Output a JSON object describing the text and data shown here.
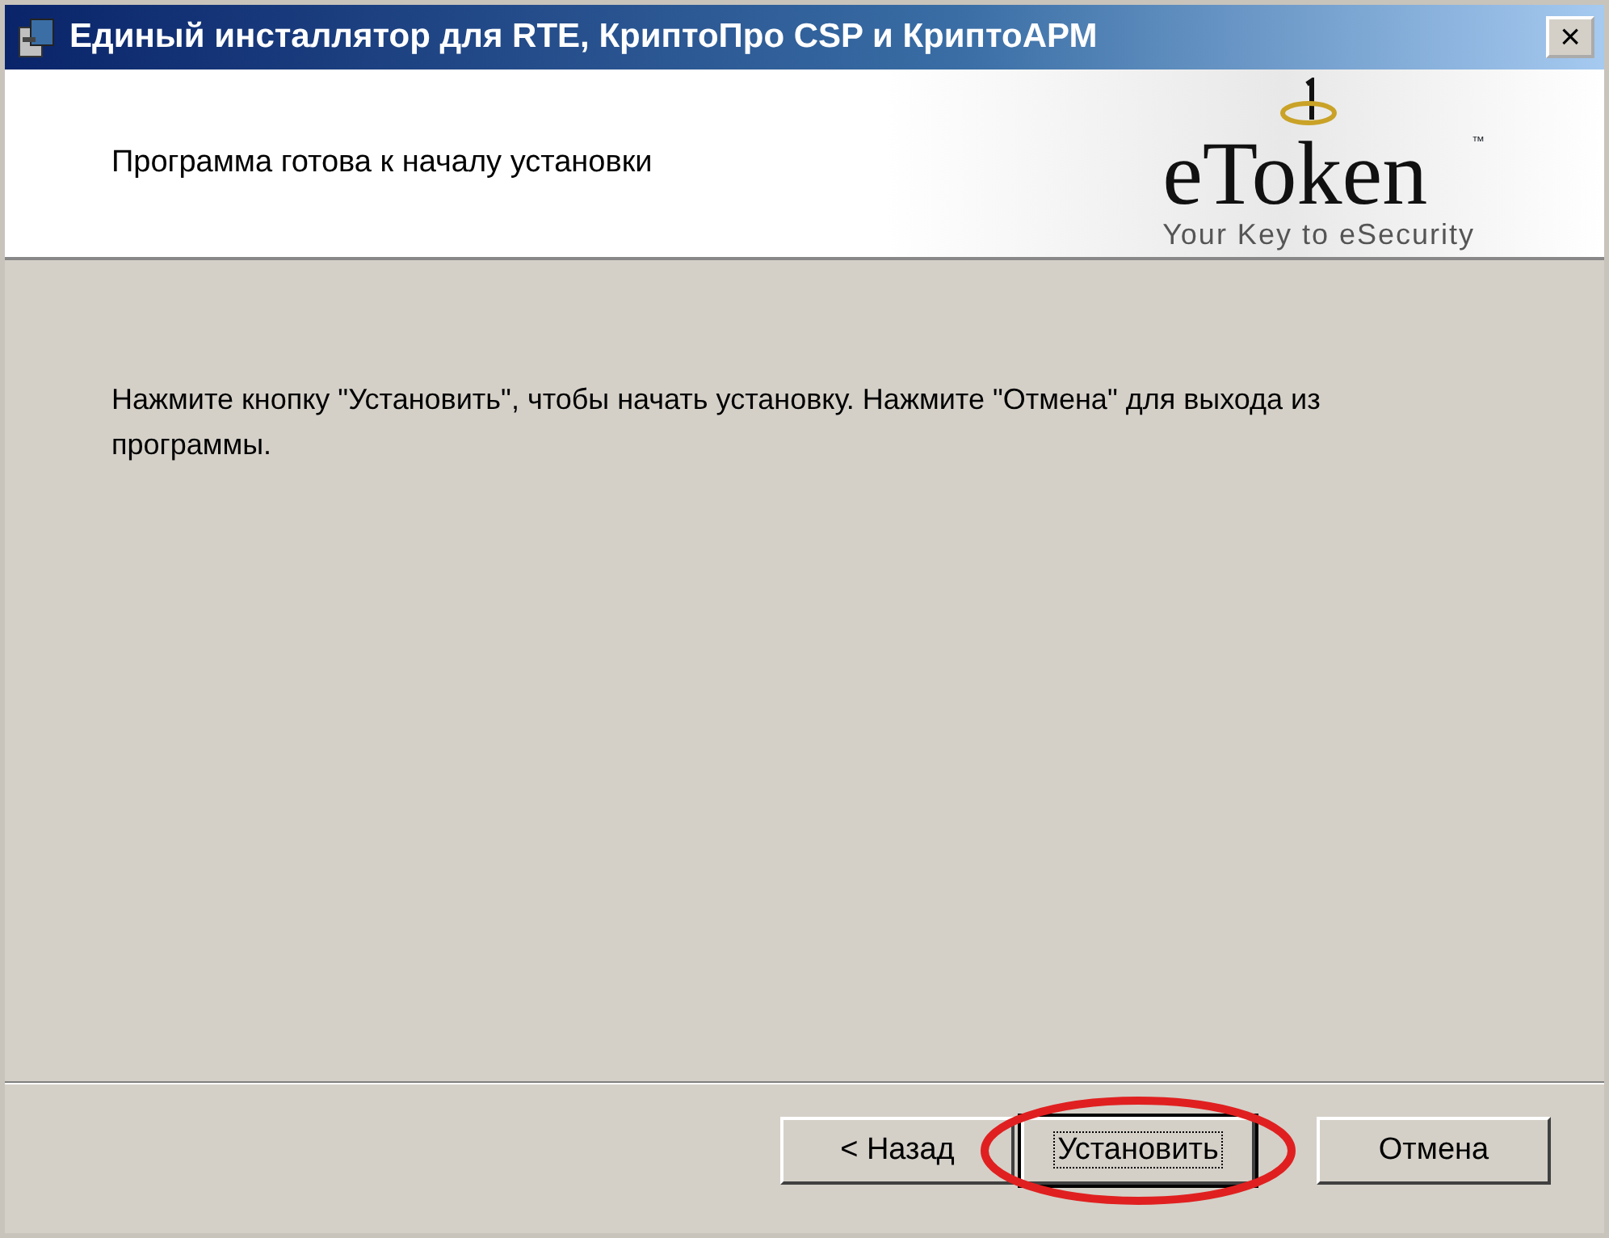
{
  "window": {
    "title": "Единый инсталлятор для RTE, КриптоПро CSP и КриптоАРМ",
    "close": "×"
  },
  "header": {
    "title": "Программа готова к началу установки",
    "logo": {
      "name": "eToken",
      "trademark": "™",
      "tagline": "Your Key to eSecurity"
    }
  },
  "body": {
    "text": "Нажмите кнопку \"Установить\", чтобы начать установку. Нажмите \"Отмена\" для выхода из программы."
  },
  "buttons": [
    {
      "label": "< Назад",
      "focused": false,
      "highlighted": false
    },
    {
      "label": "Установить",
      "focused": true,
      "highlighted": true
    },
    {
      "label": "Отмена",
      "focused": false,
      "highlighted": false
    }
  ]
}
